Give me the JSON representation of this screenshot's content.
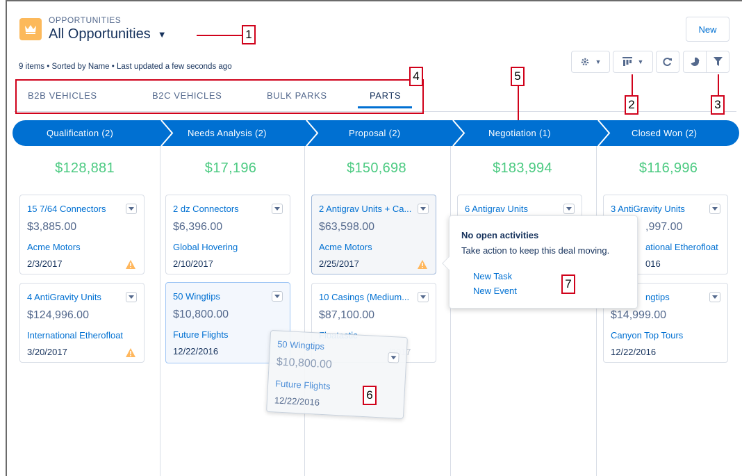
{
  "header": {
    "object_label": "OPPORTUNITIES",
    "list_title": "All Opportunities",
    "meta": "9 items • Sorted by Name • Last updated a few seconds ago",
    "new_button": "New"
  },
  "icons": {
    "app": "crown-icon",
    "settings": "gear-icon",
    "display_as": "kanban-icon",
    "refresh": "refresh-icon",
    "charts": "pie-chart-icon",
    "filter": "filter-icon",
    "warning": "warning-icon"
  },
  "colors": {
    "brand": "#0070d2",
    "total_green": "#4bca81",
    "callout_red": "#d0021b",
    "app_icon": "#fcb95b",
    "warning": "#ffb75d"
  },
  "tabs": [
    {
      "label": "B2B VEHICLES"
    },
    {
      "label": "B2C VEHICLES"
    },
    {
      "label": "BULK PARKS"
    },
    {
      "label": "PARTS",
      "active": true
    }
  ],
  "stages": [
    {
      "label": "Qualification  (2)",
      "total": "$128,881"
    },
    {
      "label": "Needs Analysis  (2)",
      "total": "$17,196"
    },
    {
      "label": "Proposal  (2)",
      "total": "$150,698"
    },
    {
      "label": "Negotiation  (1)",
      "total": "$183,994"
    },
    {
      "label": "Closed Won  (2)",
      "total": "$116,996"
    }
  ],
  "cards": {
    "q1": {
      "title": "15 7/64 Connectors",
      "amount": "$3,885.00",
      "account": "Acme Motors",
      "date": "2/3/2017",
      "warning": true
    },
    "q2": {
      "title": "4 AntiGravity Units",
      "amount": "$124,996.00",
      "account": "International Etherofloat",
      "date": "3/20/2017",
      "warning": true
    },
    "n1": {
      "title": "2 dz Connectors",
      "amount": "$6,396.00",
      "account": "Global Hovering",
      "date": "2/10/2017"
    },
    "n2": {
      "title": "50 Wingtips",
      "amount": "$10,800.00",
      "account": "Future Flights",
      "date": "12/22/2016"
    },
    "p1": {
      "title": "2 Antigrav Units + Ca...",
      "amount": "$63,598.00",
      "account": "Acme Motors",
      "date": "2/25/2017",
      "warning": true
    },
    "p2": {
      "title": "10 Casings (Medium...",
      "amount": "$87,100.00",
      "account": "Floatastic",
      "date": "4/24/2017"
    },
    "g1": {
      "title": "6 Antigrav Units"
    },
    "c1": {
      "title": "3 AntiGravity Units",
      "amount": "$115,997.00",
      "account": "International Etherofloat",
      "date": "3/6/2016"
    },
    "c2": {
      "title": "50 Wingtips",
      "amount": "$14,999.00",
      "account": "Canyon Top Tours",
      "date": "12/22/2016"
    }
  },
  "visible_fragments": {
    "c1_amount": ",997.00",
    "c1_account": "ational Etherofloat",
    "c1_date": "016",
    "c2_title": "ngtips",
    "p2_date": "/2017"
  },
  "ghost": {
    "title": "50 Wingtips",
    "amount": "$10,800.00",
    "account": "Future Flights",
    "date": "12/22/2016"
  },
  "popover": {
    "title": "No open activities",
    "subtitle": "Take action to keep this deal moving.",
    "new_task": "New Task",
    "new_event": "New Event"
  },
  "callouts": [
    "1",
    "2",
    "3",
    "4",
    "5",
    "6",
    "7"
  ]
}
